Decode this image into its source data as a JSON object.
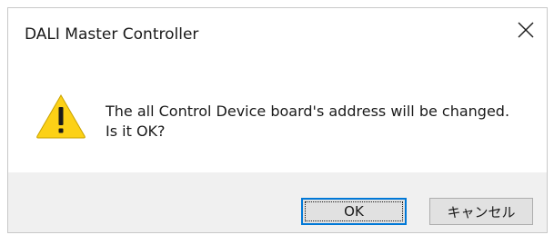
{
  "window": {
    "title": "DALI Master Controller",
    "close_icon": "close-icon"
  },
  "message": {
    "icon": "warning-icon",
    "line1": "The all Control Device board's address will be changed.",
    "line2": "Is it OK?"
  },
  "buttons": {
    "ok_label": "OK",
    "cancel_label": "キャンセル"
  },
  "colors": {
    "focus_border": "#0078d7",
    "footer_bg": "#f0f0f0",
    "warning_fill": "#fcd116"
  }
}
